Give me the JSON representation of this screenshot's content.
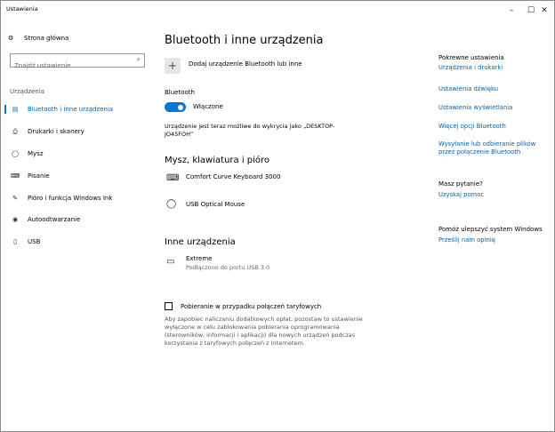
{
  "window": {
    "title": "Ustawienia",
    "minimize_glyph": "–",
    "maximize_glyph": "☐",
    "close_glyph": "✕"
  },
  "nav": {
    "home": {
      "label": "Strona główna",
      "icon": "gear-icon",
      "glyph": "⚙"
    },
    "search_placeholder": "Znajdź ustawienie",
    "search_icon": "⌕",
    "section_label": "Urządzenia",
    "items": [
      {
        "label": "Bluetooth i inne urządzenia",
        "icon": "devices-icon",
        "glyph": "▤",
        "active": true
      },
      {
        "label": "Drukarki i skanery",
        "icon": "printer-icon",
        "glyph": "⎙",
        "active": false
      },
      {
        "label": "Mysz",
        "icon": "mouse-icon",
        "glyph": "◯",
        "active": false
      },
      {
        "label": "Pisanie",
        "icon": "keyboard-icon",
        "glyph": "⌨",
        "active": false
      },
      {
        "label": "Pióro i funkcja Windows Ink",
        "icon": "pen-icon",
        "glyph": "✎",
        "active": false
      },
      {
        "label": "Autoodtwarzanie",
        "icon": "autoplay-icon",
        "glyph": "◉",
        "active": false
      },
      {
        "label": "USB",
        "icon": "usb-icon",
        "glyph": "▯",
        "active": false
      }
    ]
  },
  "main": {
    "title": "Bluetooth i inne urządzenia",
    "add_device": {
      "plus": "+",
      "label": "Dodaj urządzenie Bluetooth lub inne"
    },
    "bluetooth": {
      "label": "Bluetooth",
      "state_label": "Włączone",
      "on": true,
      "discover_text": "Urządzenie jest teraz możliwe do wykrycia jako „DESKTOP-JO45FOH”"
    },
    "input_section": {
      "title": "Mysz, klawiatura i pióro",
      "devices": [
        {
          "name": "Comfort Curve Keyboard 3000",
          "icon": "keyboard-icon",
          "glyph": "⌨"
        },
        {
          "name": "USB Optical Mouse",
          "icon": "mouse-icon",
          "glyph": "◯"
        }
      ]
    },
    "other_section": {
      "title": "Inne urządzenia",
      "devices": [
        {
          "name": "Extreme",
          "status": "Podłączono do portu USB 3.0",
          "icon": "drive-icon",
          "glyph": "▭"
        }
      ]
    },
    "metered": {
      "label": "Pobieranie w przypadku połączeń taryfowych",
      "checked": false,
      "description": "Aby zapobiec naliczaniu dodatkowych opłat, pozostaw to ustawienie wyłączone w celu zablokowania pobierania oprogramowania (sterowników, informacji i aplikacji) dla nowych urządzeń podczas korzystania z taryfowych połączeń z Internetem."
    }
  },
  "related": {
    "heading": "Pokrewne ustawienia",
    "links": [
      "Urządzenia i drukarki",
      "Ustawienia dźwięku",
      "Ustawienia wyświetlania",
      "Więcej opcji Bluetooth",
      "Wysyłanie lub odbieranie plików przez połączenie Bluetooth"
    ],
    "question_heading": "Masz pytanie?",
    "help_link": "Uzyskaj pomoc",
    "improve_heading": "Pomóż ulepszyć system Windows",
    "feedback_link": "Prześlij nam opinię"
  },
  "colors": {
    "accent": "#0078d7",
    "link": "#0063b1"
  }
}
